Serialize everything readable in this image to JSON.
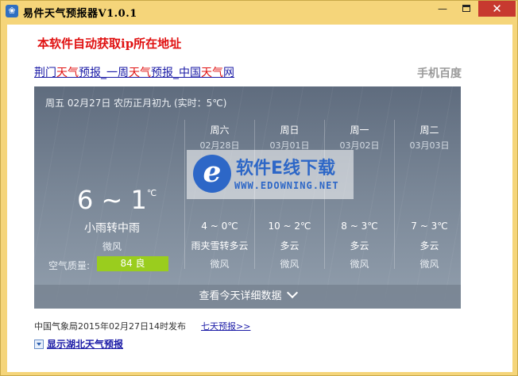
{
  "window": {
    "title": "易件天气预报器V1.0.1",
    "controls": {
      "minimize": "—",
      "close": "✕"
    }
  },
  "notice": "本软件自动获取ip所在地址",
  "page": {
    "link_parts": [
      "荆门",
      "天气",
      "预报_一周",
      "天气",
      "预报_中国",
      "天气",
      "网"
    ],
    "baidu": "手机百度"
  },
  "today": {
    "date_line": "周五 02月27日 农历正月初九 (实时：5℃)",
    "temp": "6 ~ 1",
    "unit": "℃",
    "desc": "小雨转中雨",
    "wind": "微风",
    "aq_label": "空气质量:",
    "aq_value": "84 良"
  },
  "forecast": [
    {
      "name": "周六",
      "date": "02月28日",
      "temp": "4 ~ 0℃",
      "weather": "雨夹雪转多云",
      "wind": "微风"
    },
    {
      "name": "周日",
      "date": "03月01日",
      "temp": "10 ~ 2℃",
      "weather": "多云",
      "wind": "微风"
    },
    {
      "name": "周一",
      "date": "03月02日",
      "temp": "8 ~ 3℃",
      "weather": "多云",
      "wind": "微风"
    },
    {
      "name": "周二",
      "date": "03月03日",
      "temp": "7 ~ 3℃",
      "weather": "多云",
      "wind": "微风"
    }
  ],
  "details_button": "查看今天详细数据",
  "watermark": {
    "logo": "e",
    "name": "软件E线下载",
    "url": "WWW.EDOWNING.NET"
  },
  "issued": "中国气象局2015年02月27日14时发布",
  "seven_day_link": "七天预报>>",
  "hubei_link": "显示湖北天气预报",
  "colors": {
    "titlebar": "#f5d57a",
    "close": "#c7392f",
    "notice": "#e01010",
    "aq": "#9acd1e",
    "link": "#1a1aa6"
  }
}
